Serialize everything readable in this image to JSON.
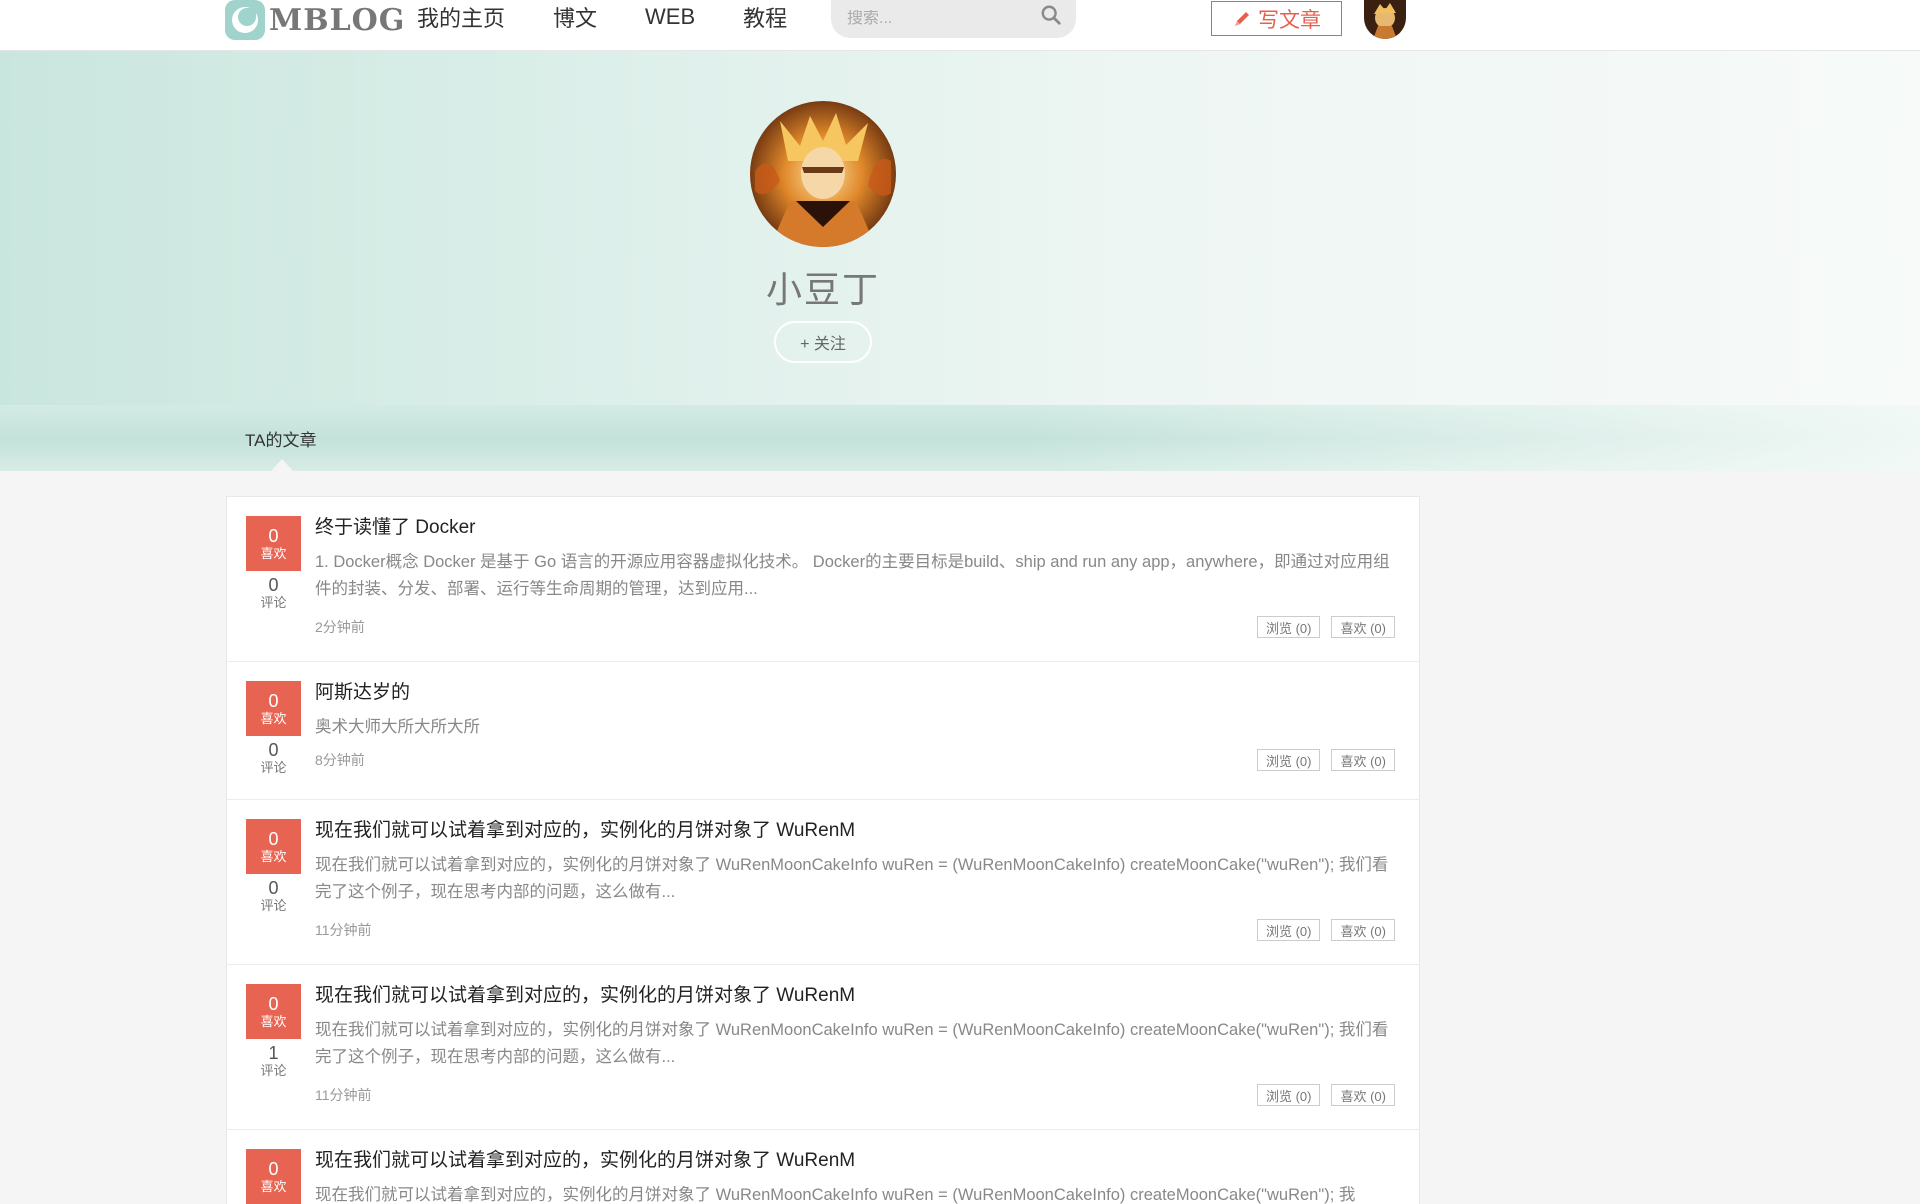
{
  "header": {
    "logo_text": "MBLOG",
    "nav": [
      "我的主页",
      "博文",
      "WEB",
      "教程"
    ],
    "search_placeholder": "搜索...",
    "write_label": "写文章"
  },
  "profile": {
    "name": "小豆丁",
    "follow_label": "+ 关注"
  },
  "tabs": {
    "articles": "TA的文章"
  },
  "posts": [
    {
      "likes": "0",
      "likes_label": "喜欢",
      "comments": "0",
      "comments_label": "评论",
      "title": "终于读懂了 Docker",
      "summary": "1. Docker概念 Docker 是基于 Go 语言的开源应用容器虚拟化技术。 Docker的主要目标是build、ship and run any app，anywhere，即通过对应用组件的封装、分发、部署、运行等生命周期的管理，达到应用...",
      "time": "2分钟前",
      "views_label": "浏览 (0)",
      "likes_chip": "喜欢 (0)"
    },
    {
      "likes": "0",
      "likes_label": "喜欢",
      "comments": "0",
      "comments_label": "评论",
      "title": "阿斯达岁的",
      "summary": "奥术大师大所大所大所",
      "time": "8分钟前",
      "views_label": "浏览 (0)",
      "likes_chip": "喜欢 (0)"
    },
    {
      "likes": "0",
      "likes_label": "喜欢",
      "comments": "0",
      "comments_label": "评论",
      "title": "现在我们就可以试着拿到对应的，实例化的月饼对象了 WuRenM",
      "summary": "现在我们就可以试着拿到对应的，实例化的月饼对象了 WuRenMoonCakeInfo wuRen = (WuRenMoonCakeInfo) createMoonCake(\"wuRen\"); 我们看完了这个例子，现在思考内部的问题，这么做有...",
      "time": "11分钟前",
      "views_label": "浏览 (0)",
      "likes_chip": "喜欢 (0)"
    },
    {
      "likes": "0",
      "likes_label": "喜欢",
      "comments": "1",
      "comments_label": "评论",
      "title": "现在我们就可以试着拿到对应的，实例化的月饼对象了 WuRenM",
      "summary": "现在我们就可以试着拿到对应的，实例化的月饼对象了 WuRenMoonCakeInfo wuRen = (WuRenMoonCakeInfo) createMoonCake(\"wuRen\"); 我们看完了这个例子，现在思考内部的问题，这么做有...",
      "time": "11分钟前",
      "views_label": "浏览 (0)",
      "likes_chip": "喜欢 (0)"
    },
    {
      "likes": "0",
      "likes_label": "喜欢",
      "title": "现在我们就可以试着拿到对应的，实例化的月饼对象了 WuRenM",
      "summary": "现在我们就可以试着拿到对应的，实例化的月饼对象了 WuRenMoonCakeInfo wuRen = (WuRenMoonCakeInfo) createMoonCake(\"wuRen\"); 我"
    }
  ],
  "colors": {
    "accent": "#e86452",
    "hero": "#c9e6de"
  },
  "icons": [
    "logo-icon",
    "search-icon",
    "pencil-icon",
    "avatar"
  ]
}
